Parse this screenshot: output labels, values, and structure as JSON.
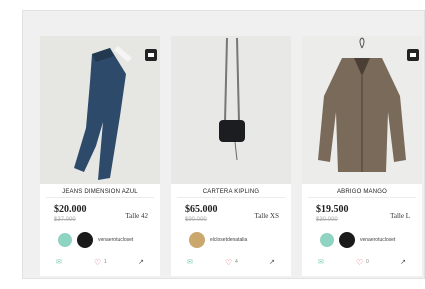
{
  "products": [
    {
      "title": "JEANS DIMENSION AZUL",
      "price": "$20.000",
      "old_price": "$37.000",
      "size": "Talle 42",
      "seller": "venaerotucloset",
      "likes": "1",
      "avatar_color": "#8fd3c2"
    },
    {
      "title": "CARTERA KIPLING",
      "price": "$65.000",
      "old_price": "$90.000",
      "size": "Talle XS",
      "seller": "elclosetdenatalia",
      "likes": "4",
      "avatar_color": "#c9a76d"
    },
    {
      "title": "ABRIGO MANGO",
      "price": "$19.500",
      "old_price": "$30.000",
      "size": "Talle L",
      "seller": "venaerotucloset",
      "likes": "0",
      "avatar_color": "#8fd3c2"
    }
  ],
  "icons": {
    "save": "bookmark-icon",
    "comment": "comment-icon",
    "like": "heart-icon",
    "share": "share-icon"
  }
}
